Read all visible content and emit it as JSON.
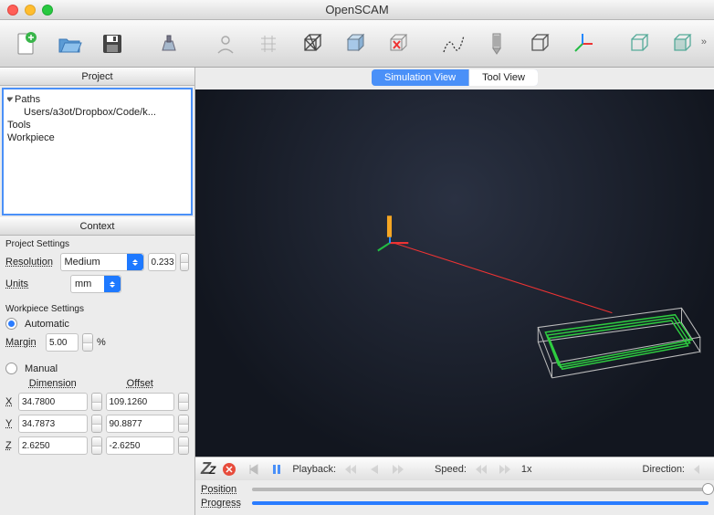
{
  "app": {
    "title": "OpenSCAM"
  },
  "sidebar": {
    "panel_project": "Project",
    "panel_context": "Context",
    "tree": {
      "paths": "Paths",
      "paths_child": "Users/a3ot/Dropbox/Code/k...",
      "tools": "Tools",
      "workpiece": "Workpiece"
    },
    "project_settings": {
      "title": "Project Settings",
      "resolution_label": "Resolution",
      "resolution_value": "Medium",
      "resolution_step": "0.233",
      "units_label": "Units",
      "units_value": "mm"
    },
    "workpiece_settings": {
      "title": "Workpiece Settings",
      "automatic": "Automatic",
      "margin_label": "Margin",
      "margin_value": "5.00",
      "margin_unit": "%",
      "manual": "Manual",
      "dim_header": "Dimension",
      "off_header": "Offset",
      "rows": [
        {
          "axis": "X",
          "dim": "34.7800",
          "off": "109.1260"
        },
        {
          "axis": "Y",
          "dim": "34.7873",
          "off": "90.8877"
        },
        {
          "axis": "Z",
          "dim": "2.6250",
          "off": "-2.6250"
        }
      ]
    }
  },
  "tabs": {
    "sim": "Simulation View",
    "tool": "Tool View"
  },
  "playback": {
    "sleep": "Z",
    "playback_label": "Playback:",
    "speed_label": "Speed:",
    "speed_value": "1x",
    "direction_label": "Direction:"
  },
  "sliders": {
    "position": "Position",
    "progress": "Progress"
  }
}
